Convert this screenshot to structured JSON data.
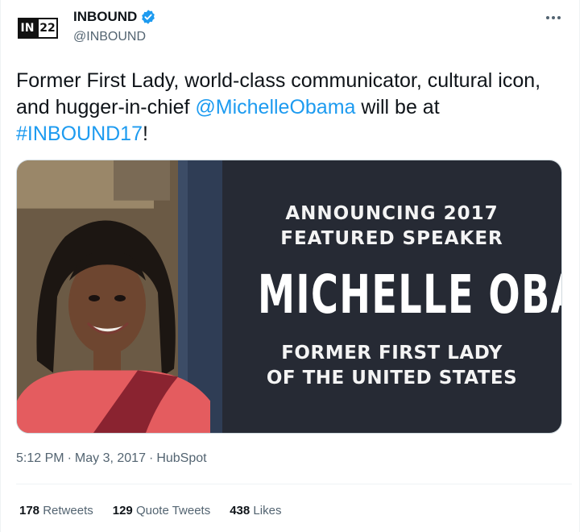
{
  "author": {
    "display_name": "INBOUND",
    "handle": "@INBOUND",
    "avatar_text_left": "IN",
    "avatar_text_right": "22",
    "verified": true
  },
  "tweet": {
    "text_before": "Former First Lady, world-class communicator, cultural icon, and hugger-in-chief ",
    "mention": "@MichelleObama",
    "text_middle": " will be at ",
    "hashtag": "#INBOUND17",
    "text_after": "!"
  },
  "media": {
    "headline_line1": "ANNOUNCING 2017",
    "headline_line2": "FEATURED SPEAKER",
    "speaker_name": "MICHELLE OBAMA",
    "subtitle_line1": "FORMER FIRST LADY",
    "subtitle_line2": "OF THE UNITED STATES"
  },
  "meta": {
    "time": "5:12 PM",
    "date": "May 3, 2017",
    "source": "HubSpot",
    "separator": "·"
  },
  "stats": [
    {
      "count": "178",
      "label": "Retweets"
    },
    {
      "count": "129",
      "label": "Quote Tweets"
    },
    {
      "count": "438",
      "label": "Likes"
    }
  ],
  "colors": {
    "link": "#1d9bf0",
    "text": "#0f1419",
    "secondary": "#536471",
    "panel": "#262a34"
  }
}
